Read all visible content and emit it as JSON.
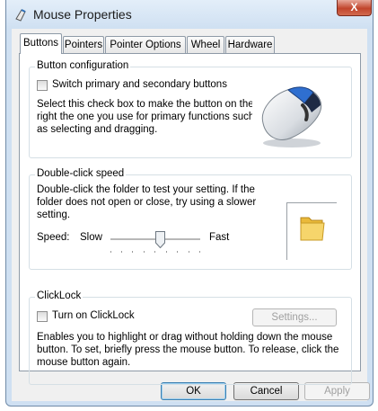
{
  "window": {
    "title": "Mouse Properties",
    "close_glyph": "X"
  },
  "tabs": [
    {
      "label": "Buttons",
      "active": true
    },
    {
      "label": "Pointers"
    },
    {
      "label": "Pointer Options"
    },
    {
      "label": "Wheel"
    },
    {
      "label": "Hardware"
    }
  ],
  "button_config": {
    "title": "Button configuration",
    "checkbox_label": "Switch primary and secondary buttons",
    "checked": false,
    "description_lines": [
      "Select this check box to make the button on the",
      "right the one you use for primary functions such",
      "as selecting and dragging."
    ],
    "image_icon": "mouse-icon"
  },
  "double_click": {
    "title": "Double-click speed",
    "description_lines": [
      "Double-click the folder to test your setting. If the",
      "folder does not open or close, try using a slower",
      "setting."
    ],
    "speed_label": "Speed:",
    "slow_label": "Slow",
    "fast_label": "Fast",
    "speed_value": 0.55,
    "test_icon": "folder-icon"
  },
  "clicklock": {
    "title": "ClickLock",
    "checkbox_label": "Turn on ClickLock",
    "checked": false,
    "settings_label": "Settings...",
    "description_lines": [
      "Enables you to highlight or drag without holding down the mouse",
      "button. To set, briefly press the mouse button. To release, click the",
      "mouse button again."
    ]
  },
  "footer": {
    "ok_label": "OK",
    "cancel_label": "Cancel",
    "apply_label": "Apply"
  },
  "colors": {
    "accent": "#3c7fb1",
    "close": "#c1452c",
    "frame": "#cfe0f2"
  }
}
